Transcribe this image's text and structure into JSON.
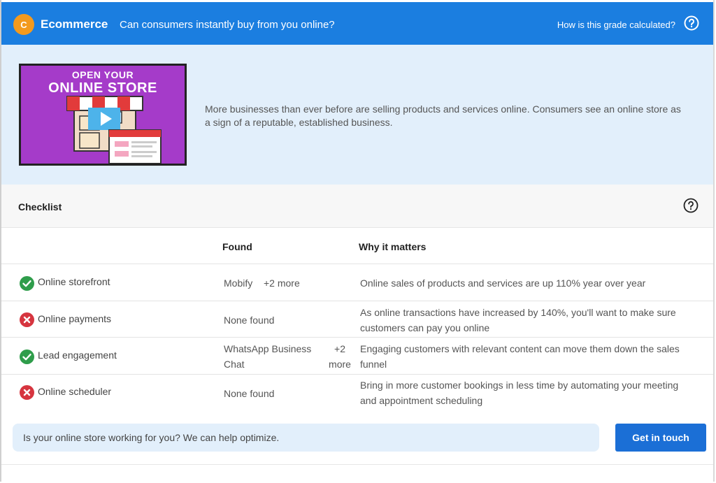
{
  "header": {
    "grade": "C",
    "title": "Ecommerce",
    "question": "Can consumers instantly buy from you online?",
    "help_link": "How is this grade calculated?"
  },
  "intro": {
    "video": {
      "headline_line1": "OPEN YOUR",
      "headline_line2": "ONLINE STORE",
      "icon": "play-icon"
    },
    "description": "More businesses than ever before are selling products and services online. Consumers see an online store as a sign of a reputable, established business."
  },
  "checklist": {
    "title": "Checklist",
    "columns": {
      "found": "Found",
      "why": "Why it matters"
    },
    "rows": [
      {
        "status": "pass",
        "name": "Online storefront",
        "found": "Mobify",
        "more": "+2 more",
        "why": "Online sales of products and services are up 110% year over year"
      },
      {
        "status": "fail",
        "name": "Online payments",
        "found": "None found",
        "more": "",
        "why": "As online transactions have increased by 140%, you'll want to make sure customers can pay you online"
      },
      {
        "status": "pass",
        "name": "Lead engagement",
        "found": "WhatsApp Business Chat",
        "more": "+2 more",
        "why": "Engaging customers with relevant content can move them down the sales funnel"
      },
      {
        "status": "fail",
        "name": "Online scheduler",
        "found": "None found",
        "more": "",
        "why": "Bring in more customer bookings in less time by automating your meeting and appointment scheduling"
      }
    ]
  },
  "cta": {
    "text": "Is your online store working for you? We can help optimize.",
    "button": "Get in touch"
  },
  "colors": {
    "header_bg": "#1b7ee0",
    "grade_badge": "#f39a1e",
    "panel_bg": "#e2effb",
    "pass": "#2f9d4b",
    "fail": "#d6353f",
    "button": "#1b6fd6"
  }
}
